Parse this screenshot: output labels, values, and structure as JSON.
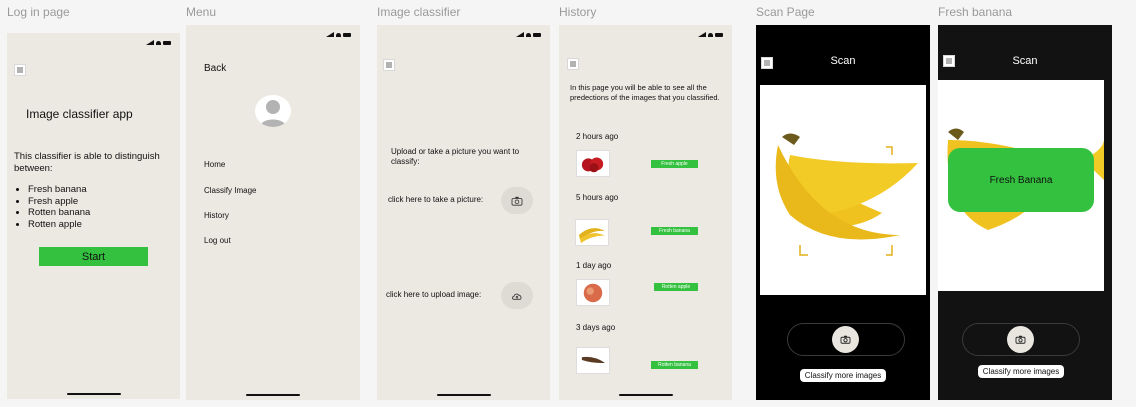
{
  "frames": {
    "login": "Log in page",
    "menu": "Menu",
    "classifier": "Image classifier",
    "history": "History",
    "scan": "Scan Page",
    "fresh": "Fresh banana"
  },
  "login": {
    "title": "Image classifier app",
    "description": "This classifier is able to distinguish between:",
    "classes": [
      "Fresh banana",
      "Fresh apple",
      "Rotten banana",
      "Rotten apple"
    ],
    "start": "Start"
  },
  "menu": {
    "back": "Back",
    "items": [
      "Home",
      "Classify Image",
      "History",
      "Log out"
    ]
  },
  "classifier": {
    "prompt": "Upload or take a picture you want to classify:",
    "take_picture": "click here to take a picture:",
    "upload": "click here to upload image:"
  },
  "history": {
    "intro": "In this page you will be able to see all the predections of the images that you classified.",
    "entries": [
      {
        "time": "2 hours ago",
        "label": "Fresh apple"
      },
      {
        "time": "5 hours ago",
        "label": "Fresh banana"
      },
      {
        "time": "1 day ago",
        "label": "Rotten apple"
      },
      {
        "time": "3 days ago",
        "label": "Rotten banana"
      }
    ]
  },
  "scan": {
    "title": "Scan",
    "classify_more": "Classify more images"
  },
  "fresh": {
    "title": "Scan",
    "result": "Fresh Banana",
    "classify_more": "Classify more images"
  },
  "colors": {
    "beige": "#ece9e2",
    "accent_green": "#33c13f",
    "dark": "#000000"
  }
}
